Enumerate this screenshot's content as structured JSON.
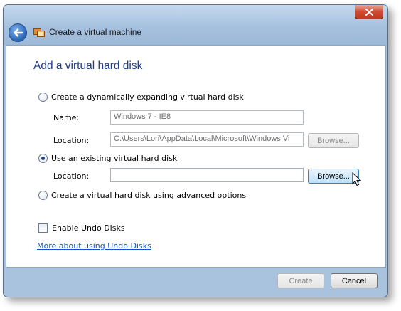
{
  "window": {
    "title": "Create a virtual machine"
  },
  "page": {
    "heading": "Add a virtual hard disk"
  },
  "options": {
    "dynamic": {
      "label": "Create a dynamically expanding virtual hard disk",
      "selected": false,
      "name_label": "Name:",
      "name_value": "Windows 7 - IE8",
      "location_label": "Location:",
      "location_value": "C:\\Users\\Lori\\AppData\\Local\\Microsoft\\Windows Vi",
      "browse_label": "Browse..."
    },
    "existing": {
      "label": "Use an existing virtual hard disk",
      "selected": true,
      "location_label": "Location:",
      "location_value": "",
      "browse_label": "Browse..."
    },
    "advanced": {
      "label": "Create a virtual hard disk using advanced options",
      "selected": false
    }
  },
  "undo": {
    "checkbox_label": "Enable Undo Disks",
    "checked": false,
    "link_text": "More about using Undo Disks"
  },
  "footer": {
    "create_label": "Create",
    "cancel_label": "Cancel"
  },
  "colors": {
    "heading": "#1e3a8a",
    "link": "#1a4fc9",
    "frame": "#a9c3df"
  },
  "icons": {
    "back": "back-arrow-icon",
    "app": "virtual-pc-icon",
    "close": "close-icon"
  }
}
